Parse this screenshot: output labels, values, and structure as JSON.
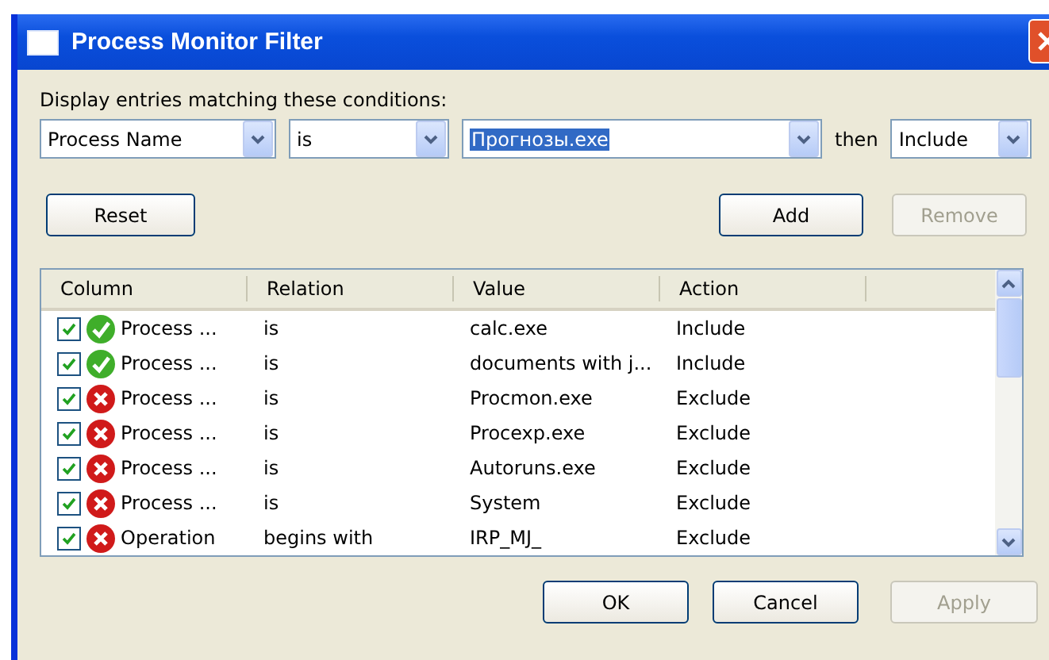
{
  "window": {
    "title": "Process Monitor Filter"
  },
  "prompt": "Display entries matching these conditions:",
  "condition": {
    "column": "Process Name",
    "relation": "is",
    "value": "Прогнозы.exe",
    "then": "then",
    "action": "Include"
  },
  "buttons_top": [
    {
      "label": "Reset",
      "disabled": false
    },
    {
      "label": "Add",
      "disabled": false
    },
    {
      "label": "Remove",
      "disabled": true
    }
  ],
  "table": {
    "columns": [
      "Column",
      "Relation",
      "Value",
      "Action"
    ],
    "rows": [
      {
        "checked": true,
        "kind": "include",
        "column": "Process ...",
        "relation": "is",
        "value": "calc.exe",
        "action": "Include"
      },
      {
        "checked": true,
        "kind": "include",
        "column": "Process ...",
        "relation": "is",
        "value": "documents with j...",
        "action": "Include"
      },
      {
        "checked": true,
        "kind": "exclude",
        "column": "Process ...",
        "relation": "is",
        "value": "Procmon.exe",
        "action": "Exclude"
      },
      {
        "checked": true,
        "kind": "exclude",
        "column": "Process ...",
        "relation": "is",
        "value": "Procexp.exe",
        "action": "Exclude"
      },
      {
        "checked": true,
        "kind": "exclude",
        "column": "Process ...",
        "relation": "is",
        "value": "Autoruns.exe",
        "action": "Exclude"
      },
      {
        "checked": true,
        "kind": "exclude",
        "column": "Process ...",
        "relation": "is",
        "value": "System",
        "action": "Exclude"
      },
      {
        "checked": true,
        "kind": "exclude",
        "column": "Operation",
        "relation": "begins with",
        "value": "IRP_MJ_",
        "action": "Exclude"
      }
    ]
  },
  "buttons_bottom": [
    {
      "label": "OK",
      "disabled": false
    },
    {
      "label": "Cancel",
      "disabled": false
    },
    {
      "label": "Apply",
      "disabled": true
    }
  ]
}
